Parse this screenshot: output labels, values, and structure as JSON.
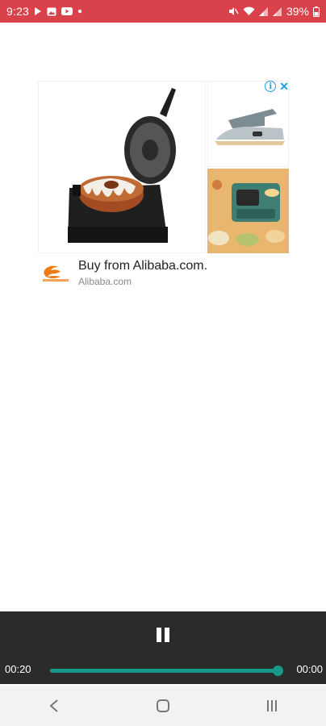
{
  "status_bar": {
    "time": "9:23",
    "battery": "39%",
    "left_icons": [
      "play-icon",
      "image-icon",
      "youtube-icon",
      "dot-icon"
    ],
    "right_icons": [
      "mute-icon",
      "wifi-icon",
      "signal-icon",
      "signal-icon",
      "battery-icon"
    ],
    "bg_color": "#d9424a"
  },
  "ad": {
    "headline": "Buy from Alibaba.com.",
    "domain": "Alibaba.com",
    "logo_text": "Alibaba.com",
    "images": [
      "bundt-cake-maker-image",
      "steam-iron-image",
      "breakfast-oven-image"
    ],
    "choices_icons": [
      "ad-info-icon",
      "ad-close-icon"
    ],
    "accent_color": "#1aa0e6"
  },
  "player": {
    "current_time": "00:20",
    "end_time": "00:00",
    "progress": 1.0,
    "state": "playing",
    "accent_color": "#16988a"
  },
  "nav_bar": {
    "buttons": [
      "back-icon",
      "home-icon",
      "recents-icon"
    ]
  }
}
